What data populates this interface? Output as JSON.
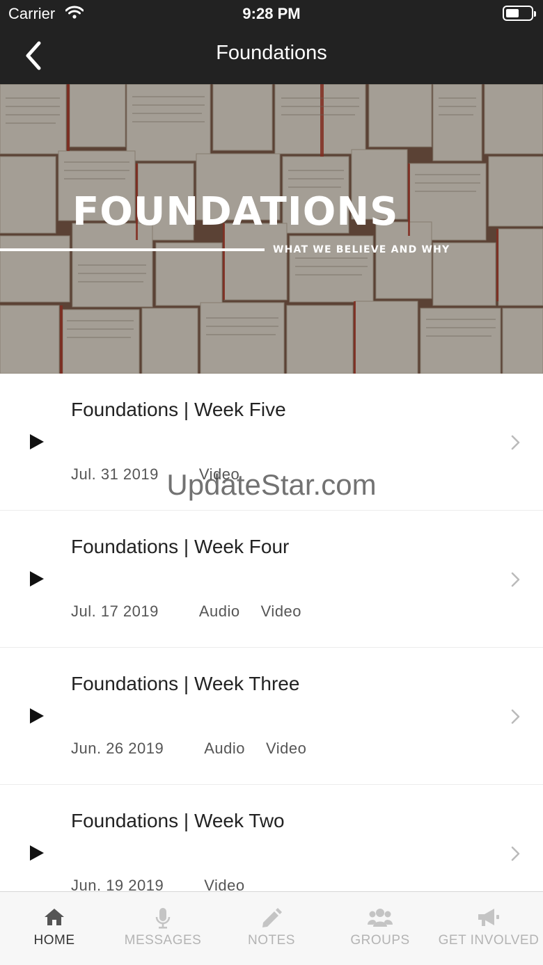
{
  "status_bar": {
    "carrier": "Carrier",
    "time": "9:28 PM"
  },
  "nav": {
    "title": "Foundations",
    "back_icon": "chevron-left-icon"
  },
  "hero": {
    "title": "FOUNDATIONS",
    "subtitle": "WHAT WE BELIEVE AND WHY"
  },
  "sermons": [
    {
      "title": "Foundations | Week Five",
      "date": "Jul. 31 2019",
      "media": [
        "Video"
      ]
    },
    {
      "title": "Foundations | Week Four",
      "date": "Jul. 17 2019",
      "media": [
        "Audio",
        "Video"
      ]
    },
    {
      "title": "Foundations | Week Three",
      "date": "Jun. 26 2019",
      "media": [
        "Audio",
        "Video"
      ]
    },
    {
      "title": "Foundations | Week Two",
      "date": "Jun. 19 2019",
      "media": [
        "Video"
      ]
    }
  ],
  "watermark": "UpdateStar.com",
  "tabs": [
    {
      "label": "HOME",
      "icon": "home-icon",
      "active": true
    },
    {
      "label": "MESSAGES",
      "icon": "microphone-icon",
      "active": false
    },
    {
      "label": "NOTES",
      "icon": "pencil-icon",
      "active": false
    },
    {
      "label": "GROUPS",
      "icon": "group-icon",
      "active": false
    },
    {
      "label": "GET INVOLVED",
      "icon": "megaphone-icon",
      "active": false
    }
  ],
  "colors": {
    "bar": "#222222",
    "tab_active": "#333333",
    "tab_inactive": "#b4b4b4"
  }
}
